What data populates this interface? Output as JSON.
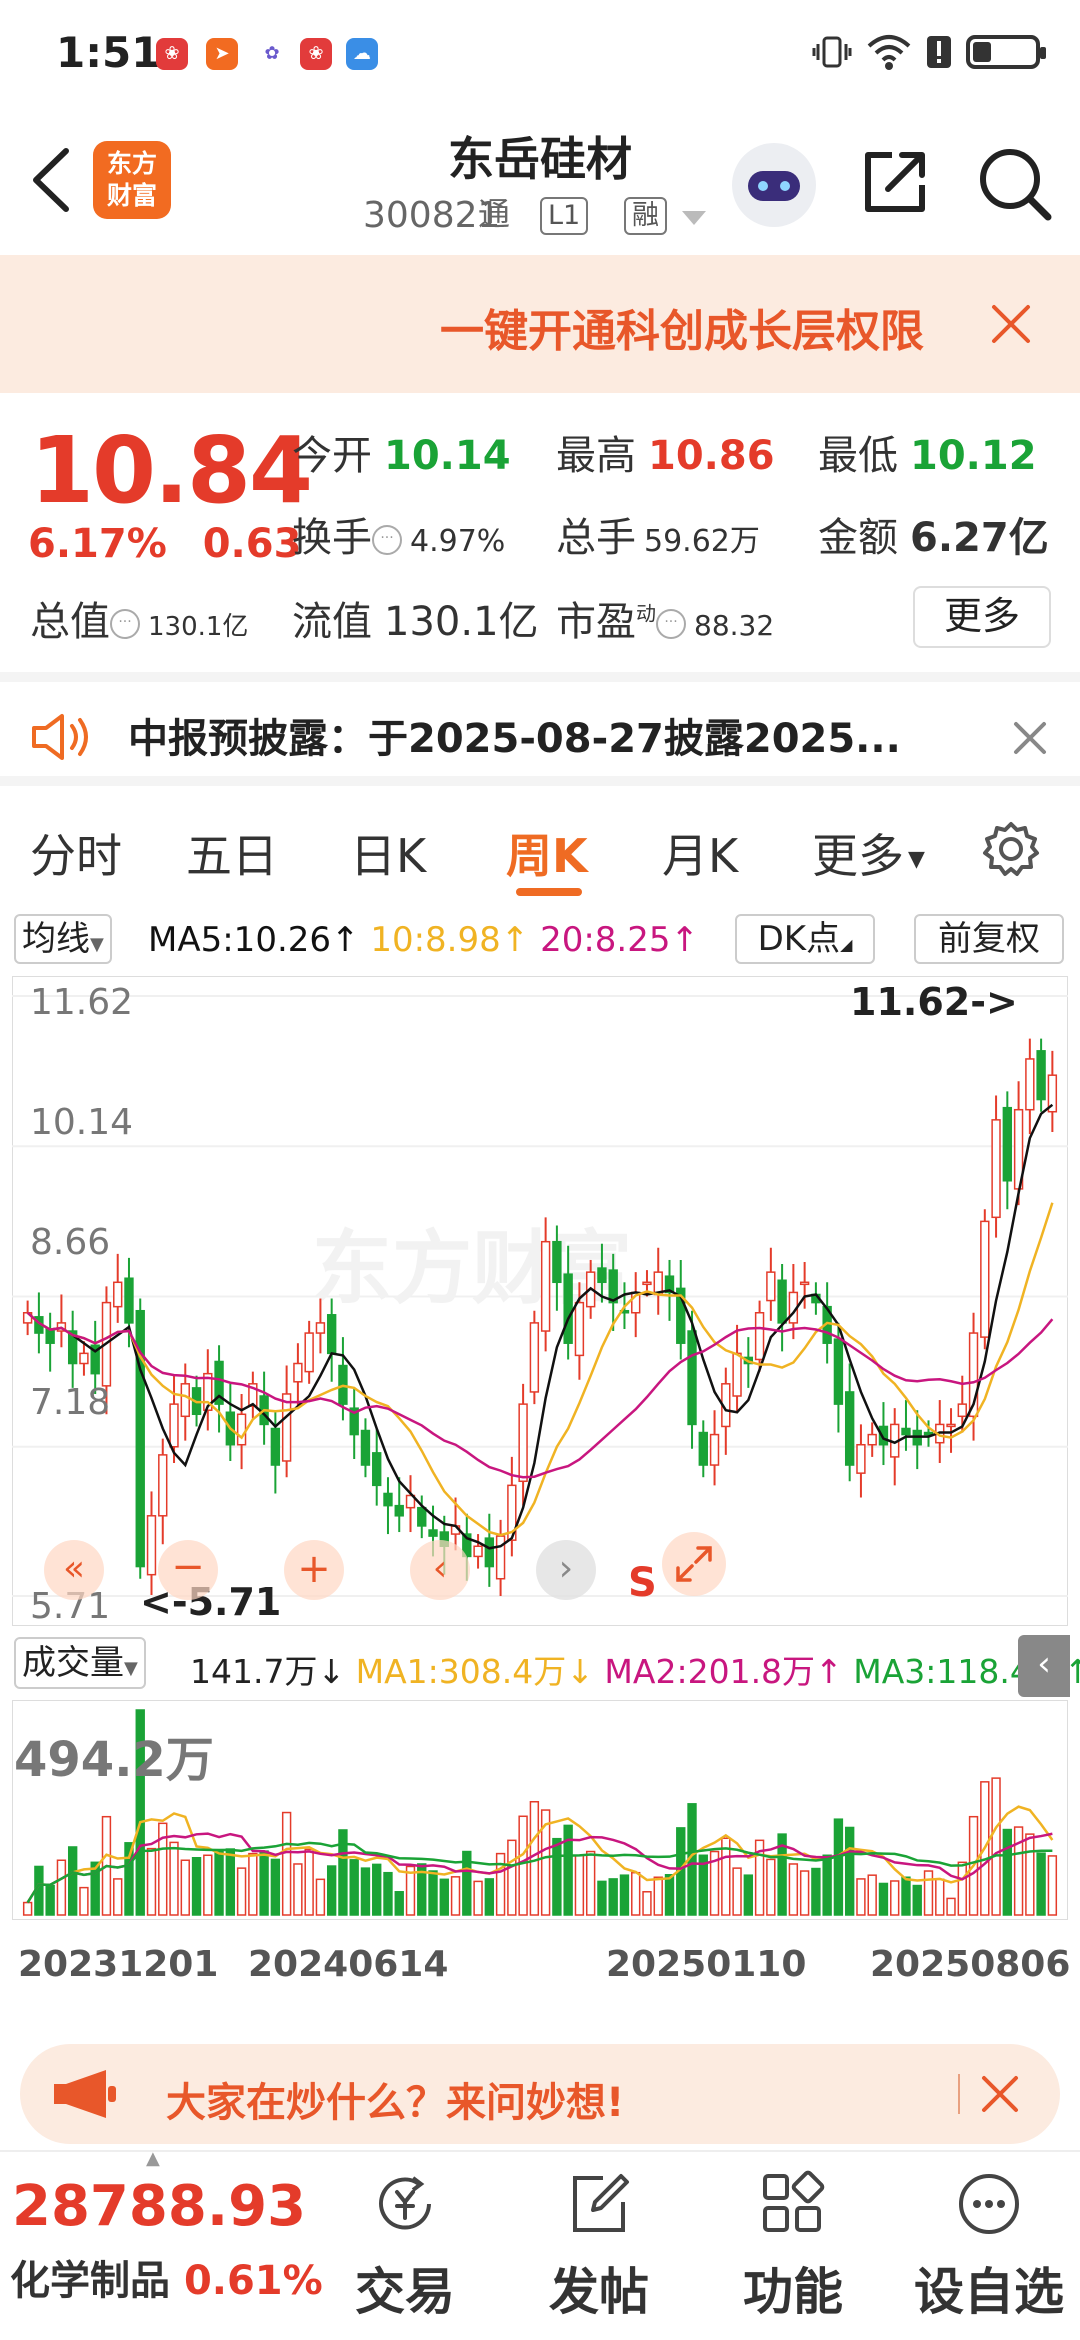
{
  "status": {
    "time": "1:51",
    "battery_level": 0.3
  },
  "header": {
    "brand": {
      "line1": "东方",
      "line2": "财富"
    },
    "stock_name": "东岳硅材",
    "stock_code": "300821",
    "tags": [
      "通",
      "L1",
      "融"
    ]
  },
  "promo": {
    "text": "一键开通科创成长层权限"
  },
  "quote": {
    "price": "10.84",
    "change_pct": "6.17%",
    "change_amt": "0.63",
    "open_label": "今开",
    "open_value": "10.14",
    "high_label": "最高",
    "high_value": "10.86",
    "low_label": "最低",
    "low_value": "10.12",
    "turnover_label": "换手",
    "turnover_value": "4.97%",
    "volume_label": "总手",
    "volume_value": "59.62万",
    "amount_label": "金额",
    "amount_value": "6.27亿",
    "mktcap_label": "总值",
    "mktcap_value": "130.1亿",
    "float_label": "流值",
    "float_value": "130.1亿",
    "pe_label": "市盈",
    "pe_sup": "动",
    "pe_value": "88.32",
    "more_label": "更多"
  },
  "notice": {
    "text": "中报预披露：于2025-08-27披露2025..."
  },
  "tabs": [
    {
      "label": "分时"
    },
    {
      "label": "五日"
    },
    {
      "label": "日K"
    },
    {
      "label": "周K"
    },
    {
      "label": "月K"
    },
    {
      "label": "更多"
    }
  ],
  "active_tab": "周K",
  "ma_bar": {
    "select": "均线",
    "ma5": "MA5:10.26↑",
    "ma10": "10:8.98↑",
    "ma20": "20:8.25↑",
    "dk": "DK点",
    "adjust": "前复权"
  },
  "kline": {
    "y_labels": [
      "11.62",
      "10.14",
      "8.66",
      "7.18",
      "5.71"
    ],
    "max_label": "11.62->",
    "min_label": "<-5.71",
    "watermark": "东方财富",
    "s_marker": "S"
  },
  "volume_bar": {
    "select": "成交量",
    "value": "141.7万↓",
    "ma1": "MA1:308.4万↓",
    "ma2": "MA2:201.8万↑",
    "ma3": "MA3:118.4万↑",
    "max_label": "494.2万"
  },
  "dates": [
    "20231201",
    "20240614",
    "20250110",
    "20250806"
  ],
  "ask": {
    "text": "大家在炒什么？来问妙想!"
  },
  "bottom": {
    "index_value": "28788.93",
    "index_name": "化学制品",
    "index_pct": "0.61%",
    "nav": [
      {
        "label": "交易"
      },
      {
        "label": "发帖"
      },
      {
        "label": "功能"
      },
      {
        "label": "设自选"
      }
    ]
  },
  "colors": {
    "up": "#e43b2a",
    "down": "#1aa336",
    "accent": "#ef6b23",
    "ma5": "#111111",
    "ma10": "#f0b323",
    "ma20": "#c8167f"
  },
  "chart_data": {
    "type": "candlestick",
    "price_axis": {
      "min": 5.71,
      "max": 11.62,
      "ticks": [
        11.62,
        10.14,
        8.66,
        7.18,
        5.71
      ]
    },
    "close_series": [
      8.5,
      8.3,
      8.2,
      8.4,
      8.0,
      8.1,
      7.9,
      8.6,
      8.8,
      8.4,
      6.0,
      6.5,
      7.1,
      7.6,
      7.8,
      7.5,
      7.9,
      7.6,
      7.2,
      7.5,
      7.8,
      7.4,
      7.0,
      7.7,
      8.0,
      8.3,
      8.4,
      8.1,
      7.6,
      7.3,
      7.0,
      6.8,
      6.6,
      6.5,
      6.7,
      6.4,
      6.3,
      6.2,
      6.4,
      6.1,
      6.2,
      6.0,
      6.3,
      6.8,
      7.6,
      8.4,
      9.2,
      8.8,
      8.2,
      8.6,
      8.9,
      8.8,
      8.6,
      8.5,
      8.7,
      8.8,
      8.9,
      8.7,
      8.2,
      7.4,
      7.0,
      7.3,
      7.8,
      8.1,
      8.0,
      8.5,
      8.9,
      8.4,
      8.7,
      8.8,
      8.6,
      8.2,
      7.6,
      7.0,
      7.2,
      7.3,
      7.2,
      7.4,
      7.3,
      7.2,
      7.3,
      7.4,
      7.4,
      7.6,
      8.3,
      9.4,
      10.4,
      9.8,
      10.5,
      11.0,
      10.6,
      10.84
    ],
    "ma5_latest": 10.26,
    "ma10_latest": 8.98,
    "ma20_latest": 8.25,
    "volume_axis": {
      "max_wan": 494.2
    },
    "volume_ma": {
      "ma1_wan": 308.4,
      "ma2_wan": 201.8,
      "ma3_wan": 118.4,
      "latest_wan": 141.7
    }
  }
}
